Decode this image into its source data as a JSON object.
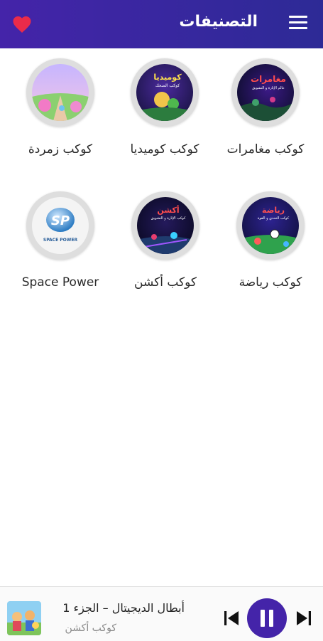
{
  "header": {
    "title": "التصنيفات",
    "favorites_icon": "heart-icon",
    "menu_icon": "hamburger-menu-icon"
  },
  "categories": [
    {
      "label": "كوكب مغامرات",
      "thumb_text": "مغامرات",
      "thumb_sub": "عالم الإثارة و التشويق"
    },
    {
      "label": "كوكب كوميديا",
      "thumb_text": "كوميديا",
      "thumb_sub": "كوكب الضحك"
    },
    {
      "label": "كوكب زمردة"
    },
    {
      "label": "كوكب رياضة",
      "thumb_text": "رياضة",
      "thumb_sub": "كوكب التحدي و القوة"
    },
    {
      "label": "كوكب أكشن",
      "thumb_text": "أكشن",
      "thumb_sub": "كوكب الإثارة و التشويق"
    },
    {
      "label": "Space Power",
      "thumb_text": "SPACE POWER"
    }
  ],
  "player": {
    "title": "أبطال الديجيتال – الجزء 1",
    "subtitle": "كوكب أكشن",
    "prev_icon": "skip-previous-icon",
    "pause_icon": "pause-icon",
    "next_icon": "skip-next-icon"
  },
  "colors": {
    "header_start": "#4424a9",
    "header_end": "#2d2a96",
    "accent": "#4424a9",
    "heart": "#ea2b4a"
  }
}
